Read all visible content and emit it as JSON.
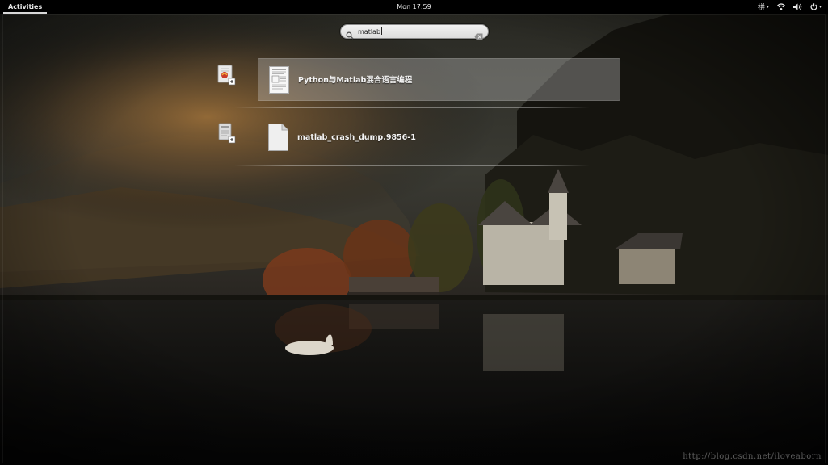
{
  "topbar": {
    "activities_label": "Activities",
    "clock": "Mon 17:59",
    "input_method": "拼",
    "caret": "▾"
  },
  "search": {
    "value": "matlab",
    "icon": "search-icon",
    "clear_icon": "clear-entry-icon"
  },
  "results": [
    {
      "provider_icon": "document-viewer-app-icon",
      "file_icon": "pdf-document-thumbnail",
      "name": "Python与Matlab混合语言编程",
      "selected": true
    },
    {
      "provider_icon": "text-editor-app-icon",
      "file_icon": "text-document-icon",
      "name": "matlab_crash_dump.9856-1",
      "selected": false
    }
  ],
  "watermark": "http://blog.csdn.net/iloveaborn",
  "colors": {
    "topbar": "#000000",
    "selected_row": "rgba(215,215,215,0.32)",
    "result_text": "#f4f4f4"
  }
}
